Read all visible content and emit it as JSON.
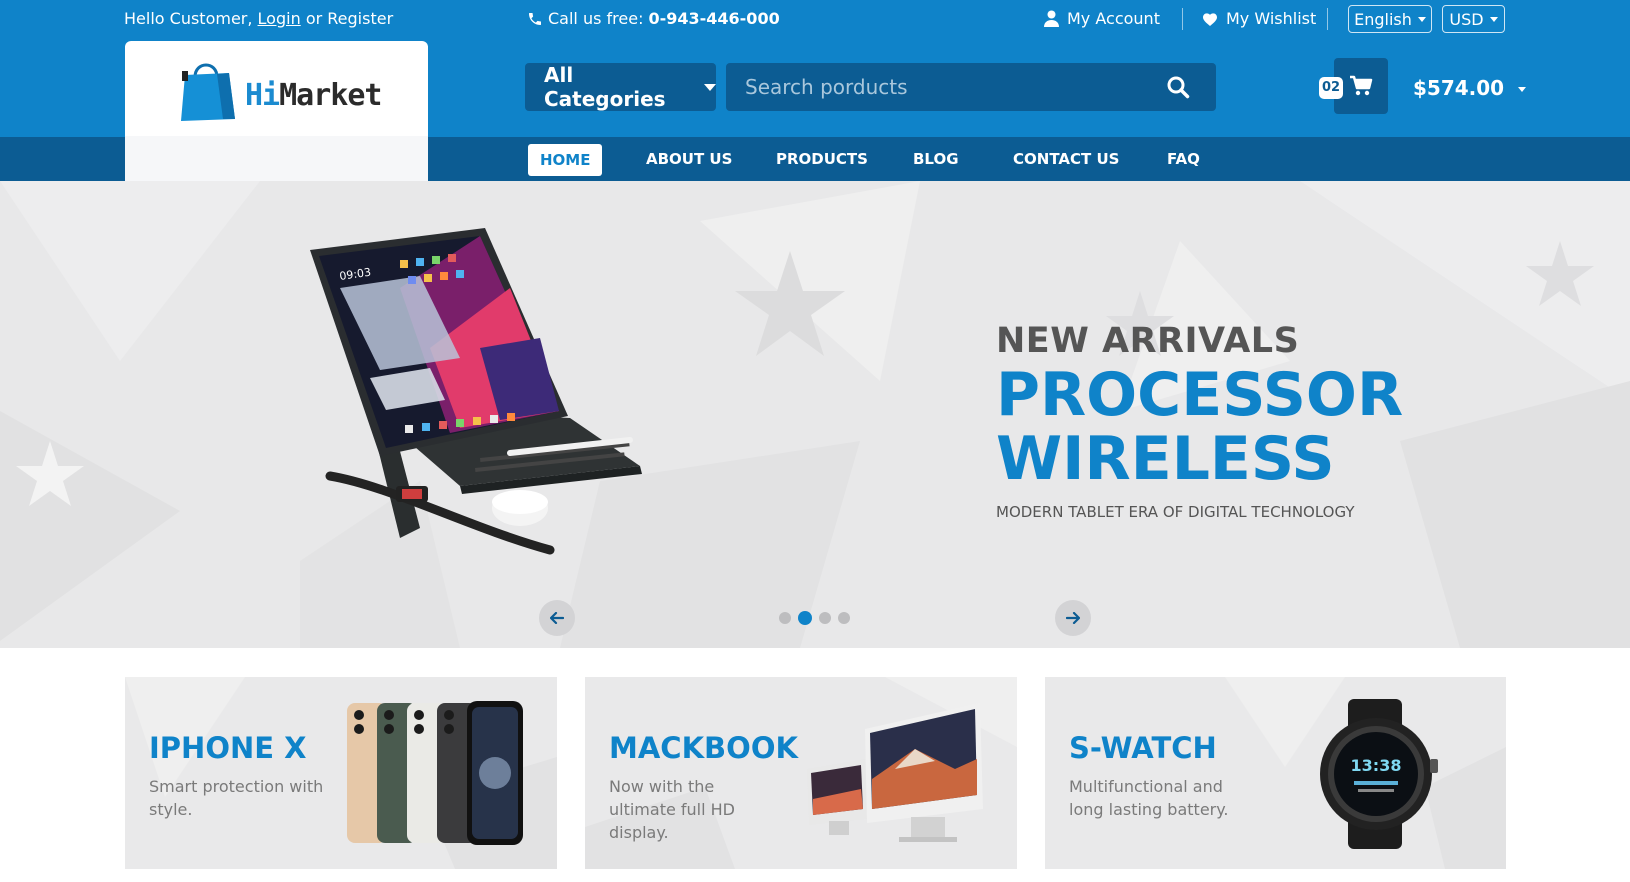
{
  "topbar": {
    "hello": "Hello Customer,",
    "login": "Login",
    "or": "or",
    "register": "Register",
    "call_label": "Call us free:",
    "phone": "0-943-446-000",
    "account": "My Account",
    "wishlist": "My Wishlist",
    "language": "English",
    "currency": "USD"
  },
  "logo": {
    "hi": "Hi",
    "market": "Market"
  },
  "search": {
    "category": "All Categories",
    "placeholder": "Search porducts"
  },
  "cart": {
    "count": "02",
    "total": "$574.00"
  },
  "nav": {
    "items": [
      {
        "label": "Home"
      },
      {
        "label": "About Us"
      },
      {
        "label": "Products"
      },
      {
        "label": "Blog"
      },
      {
        "label": "Contact Us"
      },
      {
        "label": "FAQ"
      }
    ]
  },
  "hero": {
    "kicker": "NEW ARRIVALS",
    "title_line1": "PROCESSOR",
    "title_line2": "WIRELESS",
    "subtitle": "MODERN TABLET ERA OF DIGITAL TECHNOLOGY",
    "tablet_time": "09:03"
  },
  "banners": [
    {
      "title": "IPHONE X",
      "desc": "Smart protection with style."
    },
    {
      "title": "MACKBOOK",
      "desc": "Now with the ultimate full HD display."
    },
    {
      "title": "S-WATCH",
      "desc": "Multifunctional and long lasting battery.",
      "watch_time": "13:38"
    }
  ],
  "colors": {
    "primary": "#0f83c9",
    "dark": "#0c5c93",
    "hero_bg": "#e8e8e9"
  }
}
